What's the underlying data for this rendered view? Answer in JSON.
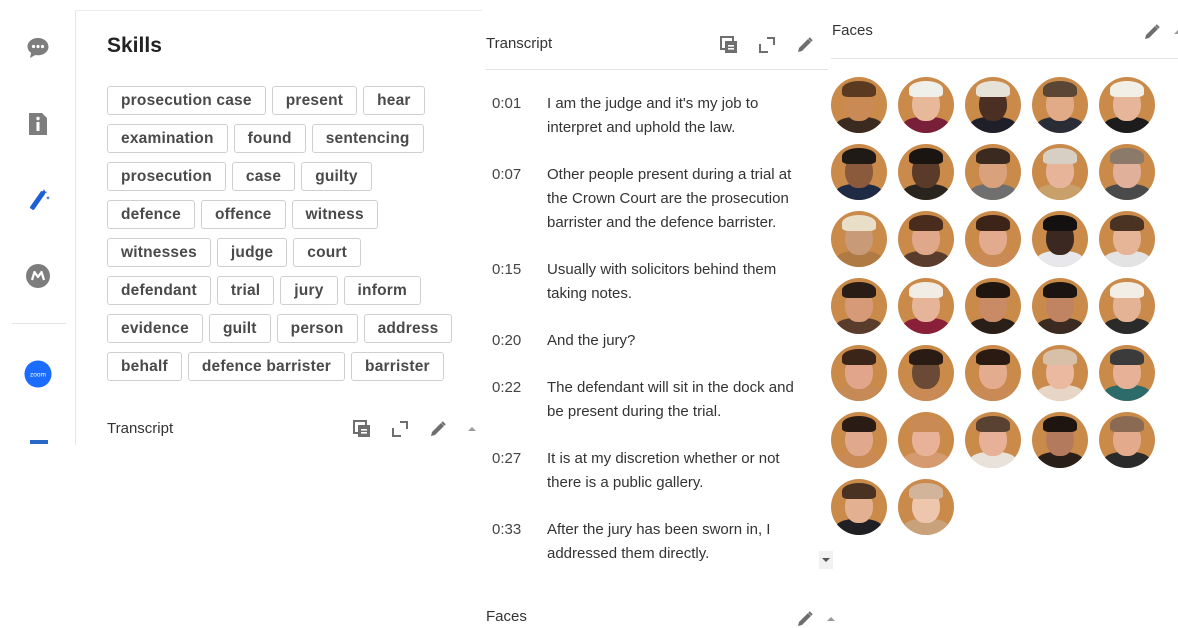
{
  "rail": {
    "icons": [
      "chat-icon",
      "info-icon",
      "magic-wand-icon",
      "m-logo-icon",
      "zoom-icon"
    ],
    "zoom_label": "zoom"
  },
  "skills": {
    "title": "Skills",
    "rows": [
      [
        "prosecution case",
        "present",
        "hear"
      ],
      [
        "examination",
        "found",
        "sentencing"
      ],
      [
        "prosecution",
        "case",
        "guilty"
      ],
      [
        "defence",
        "offence",
        "witness"
      ],
      [
        "witnesses",
        "judge",
        "court"
      ],
      [
        "defendant",
        "trial",
        "jury",
        "inform"
      ],
      [
        "evidence",
        "guilt",
        "person",
        "address"
      ],
      [
        "behalf",
        "defence barrister",
        "barrister"
      ]
    ]
  },
  "left_transcript": {
    "label": "Transcript"
  },
  "transcript": {
    "label": "Transcript",
    "entries": [
      {
        "time": "0:01",
        "text": "I am the judge and it's my job to interpret and uphold the law."
      },
      {
        "time": "0:07",
        "text": "Other people present during a trial at the Crown Court are the prosecution barrister and the defence barrister."
      },
      {
        "time": "0:15",
        "text": "Usually with solicitors behind them taking notes."
      },
      {
        "time": "0:20",
        "text": "And the jury?"
      },
      {
        "time": "0:22",
        "text": "The defendant will sit in the dock and be present during the trial."
      },
      {
        "time": "0:27",
        "text": "It is at my discretion whether or not there is a public gallery."
      },
      {
        "time": "0:33",
        "text": "After the jury has been sworn in, I addressed them directly."
      }
    ]
  },
  "bottom_faces": {
    "label": "Faces"
  },
  "faces": {
    "label": "Faces",
    "thumbnails": [
      {
        "skin": "#c98a55",
        "hair": "#5a3b22",
        "body": "#3a2a20"
      },
      {
        "skin": "#e8b89a",
        "hair": "#f0f0ea",
        "body": "#7a1f3a"
      },
      {
        "skin": "#4a2f22",
        "hair": "#e6e2d8",
        "body": "#1f1f2a"
      },
      {
        "skin": "#e2ab88",
        "hair": "#5b4636",
        "body": "#2a2d36"
      },
      {
        "skin": "#e7b69a",
        "hair": "#f2efe6",
        "body": "#1c1c1c"
      },
      {
        "skin": "#8b5a3c",
        "hair": "#1f1a16",
        "body": "#1f2a44"
      },
      {
        "skin": "#5a3a28",
        "hair": "#1b1512",
        "body": "#2a241f"
      },
      {
        "skin": "#d9a27c",
        "hair": "#3b2a1f",
        "body": "#6f6f6f"
      },
      {
        "skin": "#e7b49a",
        "hair": "#d8cfc4",
        "body": "#c9a06a"
      },
      {
        "skin": "#e1b09a",
        "hair": "#8b7a6a",
        "body": "#4a4a4a"
      },
      {
        "skin": "#c89a78",
        "hair": "#e9dfc8",
        "body": "#b07a44"
      },
      {
        "skin": "#e0a88a",
        "hair": "#4a2c1c",
        "body": "#5a3c2c"
      },
      {
        "skin": "#e3ab8e",
        "hair": "#3d2418",
        "body": "#c98a55"
      },
      {
        "skin": "#3b2820",
        "hair": "#141010",
        "body": "#e8e8ec"
      },
      {
        "skin": "#e6b496",
        "hair": "#4a3322",
        "body": "#e3e3e3"
      },
      {
        "skin": "#d79a78",
        "hair": "#2a1d16",
        "body": "#5a3c2c"
      },
      {
        "skin": "#e6b599",
        "hair": "#f1ede4",
        "body": "#8a1f3a"
      },
      {
        "skin": "#c98a66",
        "hair": "#20160f",
        "body": "#2a1e18"
      },
      {
        "skin": "#c18462",
        "hair": "#1c1410",
        "body": "#3a2a22"
      },
      {
        "skin": "#e4b294",
        "hair": "#f2eee6",
        "body": "#2a2a2a"
      },
      {
        "skin": "#e0a58a",
        "hair": "#3b2418",
        "body": "#c58a55"
      },
      {
        "skin": "#6a4a36",
        "hair": "#2a1c14",
        "body": "#c98a55"
      },
      {
        "skin": "#e3ac8e",
        "hair": "#2a1a12",
        "body": "#c98a55"
      },
      {
        "skin": "#eab9a0",
        "hair": "#d8c0a8",
        "body": "#e7d5c6"
      },
      {
        "skin": "#e6b196",
        "hair": "#3b3b3b",
        "body": "#2c6b6a"
      },
      {
        "skin": "#e0a88c",
        "hair": "#2a1c14",
        "body": "#c98a55"
      },
      {
        "skin": "#e8b298",
        "hair": "#c98a55",
        "body": "#d69a70"
      },
      {
        "skin": "#e6b196",
        "hair": "#5a4232",
        "body": "#e8e2da"
      },
      {
        "skin": "#b47a5e",
        "hair": "#1e1410",
        "body": "#2a1e18"
      },
      {
        "skin": "#e3aa8c",
        "hair": "#8a6a52",
        "body": "#2a2a2a"
      },
      {
        "skin": "#e4b092",
        "hair": "#4a3222",
        "body": "#1f1f24"
      },
      {
        "skin": "#eec6ae",
        "hair": "#d2b49a",
        "body": "#c9a27c"
      }
    ]
  }
}
